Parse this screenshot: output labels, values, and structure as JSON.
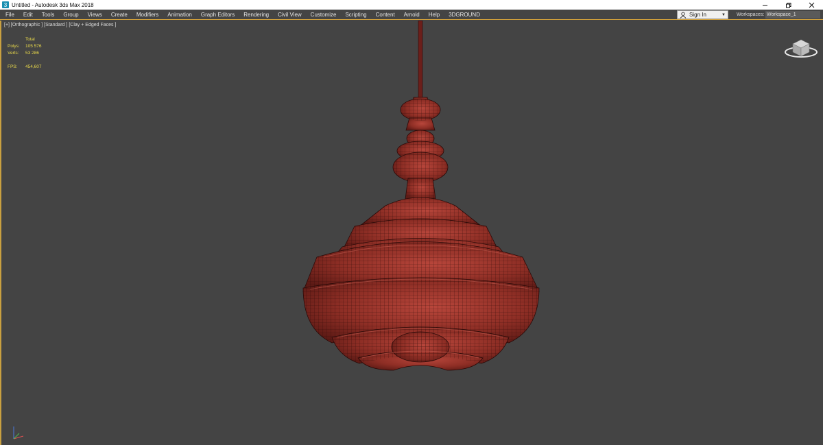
{
  "window": {
    "title": "Untitled - Autodesk 3ds Max 2018"
  },
  "menu": {
    "items": [
      "File",
      "Edit",
      "Tools",
      "Group",
      "Views",
      "Create",
      "Modifiers",
      "Animation",
      "Graph Editors",
      "Rendering",
      "Civil View",
      "Customize",
      "Scripting",
      "Content",
      "Arnold",
      "Help",
      "3DGROUND"
    ]
  },
  "account": {
    "signin_label": "Sign In"
  },
  "workspaces": {
    "label": "Workspaces:",
    "value": "Workspace_1"
  },
  "viewport": {
    "label": "[+] [Orthographic ] [Standard ] [Clay + Edged Faces ]",
    "stats": {
      "header": "Total",
      "polys_label": "Polys:",
      "polys_value": "105 576",
      "verts_label": "Verts:",
      "verts_value": "53 286",
      "fps_label": "FPS:",
      "fps_value": "454,607"
    }
  },
  "colors": {
    "accent": "#d6a33a",
    "viewport_bg": "#444444",
    "stats_text": "#e8d84a",
    "model_fill": "#8b2b22"
  },
  "icons": {
    "app": "3dsmax-app-icon",
    "user": "user-icon",
    "viewcube": "viewcube-icon",
    "axis": "axis-tripod-icon"
  }
}
